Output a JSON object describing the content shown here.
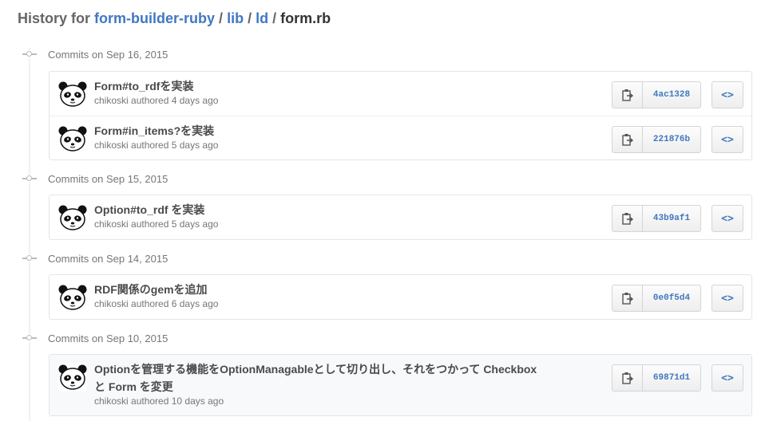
{
  "title": {
    "prefix": "History for",
    "repo": "form-builder-ruby",
    "sep1": "/",
    "dir1": "lib",
    "sep2": "/",
    "dir2": "ld",
    "sep3": "/",
    "file": "form.rb"
  },
  "groups": [
    {
      "heading": "Commits on Sep 16, 2015",
      "commits": [
        {
          "message": "Form#to_rdfを実装",
          "author": "chikoski",
          "meta": "authored 4 days ago",
          "sha": "4ac1328"
        },
        {
          "message": "Form#in_items?を実装",
          "author": "chikoski",
          "meta": "authored 5 days ago",
          "sha": "221876b"
        }
      ]
    },
    {
      "heading": "Commits on Sep 15, 2015",
      "commits": [
        {
          "message": "Option#to_rdf を実装",
          "author": "chikoski",
          "meta": "authored 5 days ago",
          "sha": "43b9af1"
        }
      ]
    },
    {
      "heading": "Commits on Sep 14, 2015",
      "commits": [
        {
          "message": "RDF関係のgemを追加",
          "author": "chikoski",
          "meta": "authored 6 days ago",
          "sha": "0e0f5d4"
        }
      ]
    },
    {
      "heading": "Commits on Sep 10, 2015",
      "commits": [
        {
          "message": "Optionを管理する機能をOptionManagableとして切り出し、それをつかって Checkbox と Form を変更",
          "author": "chikoski",
          "meta": "authored 10 days ago",
          "sha": "69871d1"
        }
      ]
    }
  ],
  "icons": {
    "timeline": "commit-dot-icon",
    "copy": "clipboard-icon",
    "browse": "code-brackets-icon",
    "avatar": "panda-avatar"
  },
  "browse_label": "<>",
  "colors": {
    "link": "#4078c0",
    "muted": "#767676",
    "border": "#e5e5e5"
  }
}
